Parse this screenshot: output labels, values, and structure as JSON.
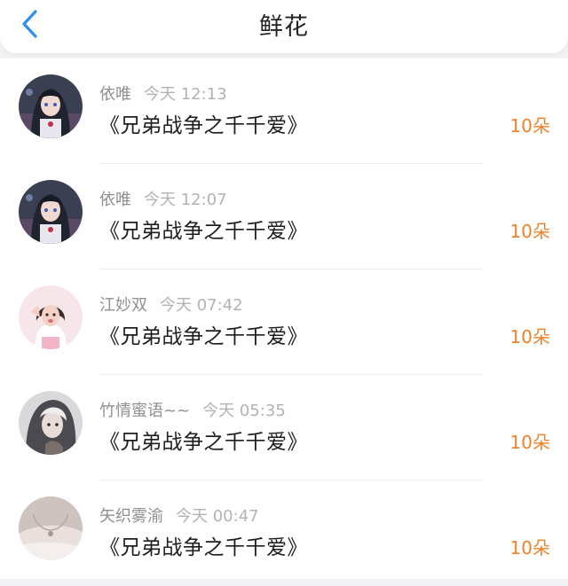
{
  "header": {
    "title": "鲜花",
    "back_icon": "chevron-left-icon"
  },
  "colors": {
    "accent_blue": "#2e8ff0",
    "count_orange": "#f0822a",
    "meta_gray": "#9a9a9a"
  },
  "records": [
    {
      "user": "依唯",
      "time": "今天 12:13",
      "work": "《兄弟战争之千千爱》",
      "count": "10朵",
      "avatar": "anime-girl-dark"
    },
    {
      "user": "依唯",
      "time": "今天 12:07",
      "work": "《兄弟战争之千千爱》",
      "count": "10朵",
      "avatar": "anime-girl-dark"
    },
    {
      "user": "江妙双",
      "time": "今天 07:42",
      "work": "《兄弟战争之千千爱》",
      "count": "10朵",
      "avatar": "photo-girl-pink"
    },
    {
      "user": "竹情蜜语~~",
      "time": "今天 05:35",
      "work": "《兄弟战争之千千爱》",
      "count": "10朵",
      "avatar": "anime-boy-gray"
    },
    {
      "user": "矢织雾渝",
      "time": "今天 00:47",
      "work": "《兄弟战争之千千爱》",
      "count": "10朵",
      "avatar": "necklace-photo"
    }
  ]
}
